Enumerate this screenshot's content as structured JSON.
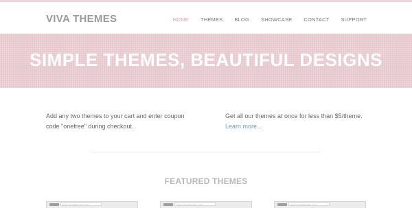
{
  "header": {
    "logo": "VIVA THEMES",
    "nav": [
      "HOME",
      "THEMES",
      "BLOG",
      "SHOWCASE",
      "CONTACT",
      "SUPPORT"
    ],
    "active_nav": "HOME"
  },
  "hero": {
    "title": "SIMPLE THEMES, BEAUTIFUL DESIGNS"
  },
  "promo": {
    "left_text": "Add any two themes to your cart and enter coupon code \"onefree\" during checkout.",
    "right_text": "Get all our themes at once for less than $5/theme.",
    "right_link": "Learn more..."
  },
  "featured": {
    "title": "FEATURED THEMES",
    "thumb_urls": [
      "www.vivathemes.com",
      "www.vivathemes.com",
      "www.vivathemes.com"
    ]
  },
  "colors": {
    "hero_bg": "#e6c7cd",
    "active_nav": "#e3a6b3",
    "link": "#6aa3cf"
  }
}
